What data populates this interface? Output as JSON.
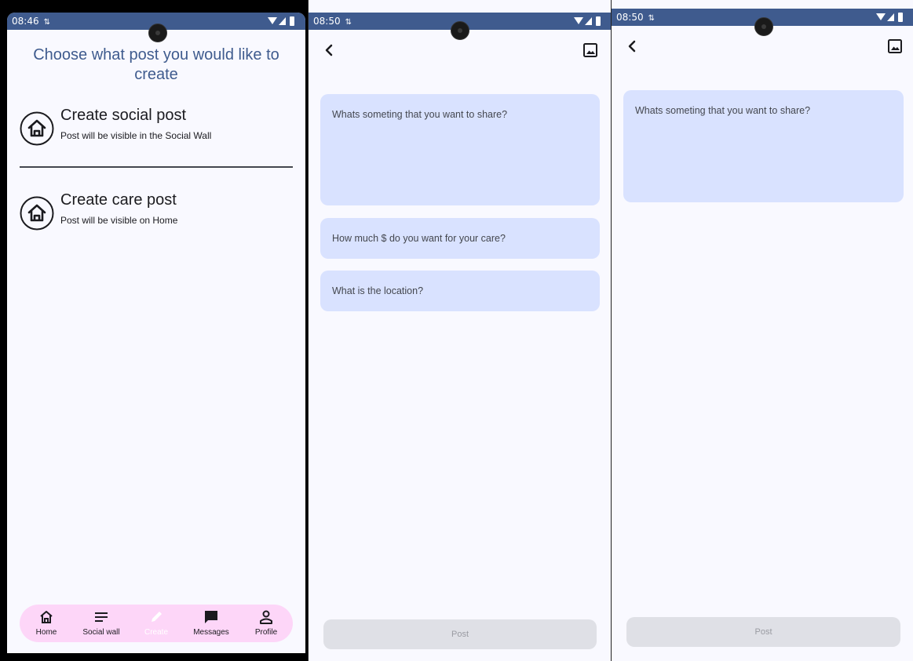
{
  "screen1": {
    "status_time": "08:46",
    "title": "Choose what post you would like to create",
    "options": [
      {
        "title": "Create social post",
        "subtitle": "Post will be visible in the Social Wall"
      },
      {
        "title": "Create care post",
        "subtitle": "Post will be visible on Home"
      }
    ],
    "nav": [
      {
        "label": "Home",
        "icon": "home-icon"
      },
      {
        "label": "Social wall",
        "icon": "list-icon"
      },
      {
        "label": "Create",
        "icon": "pencil-icon"
      },
      {
        "label": "Messages",
        "icon": "message-icon"
      },
      {
        "label": "Profile",
        "icon": "person-icon"
      }
    ],
    "nav_bg": "#fdd6f8"
  },
  "screen2": {
    "status_time": "08:50",
    "share_placeholder": "Whats someting that you want to share?",
    "price_placeholder": "How much $ do you want for your care?",
    "location_placeholder": "What is the location?",
    "post_label": "Post"
  },
  "screen3": {
    "status_time": "08:50",
    "share_placeholder": "Whats someting that you want to share?",
    "post_label": "Post"
  },
  "colors": {
    "status_bar": "#3f5b8e",
    "title": "#3f5b8e",
    "field_bg": "#d9e2ff",
    "button_disabled": "#dfe0e6"
  }
}
